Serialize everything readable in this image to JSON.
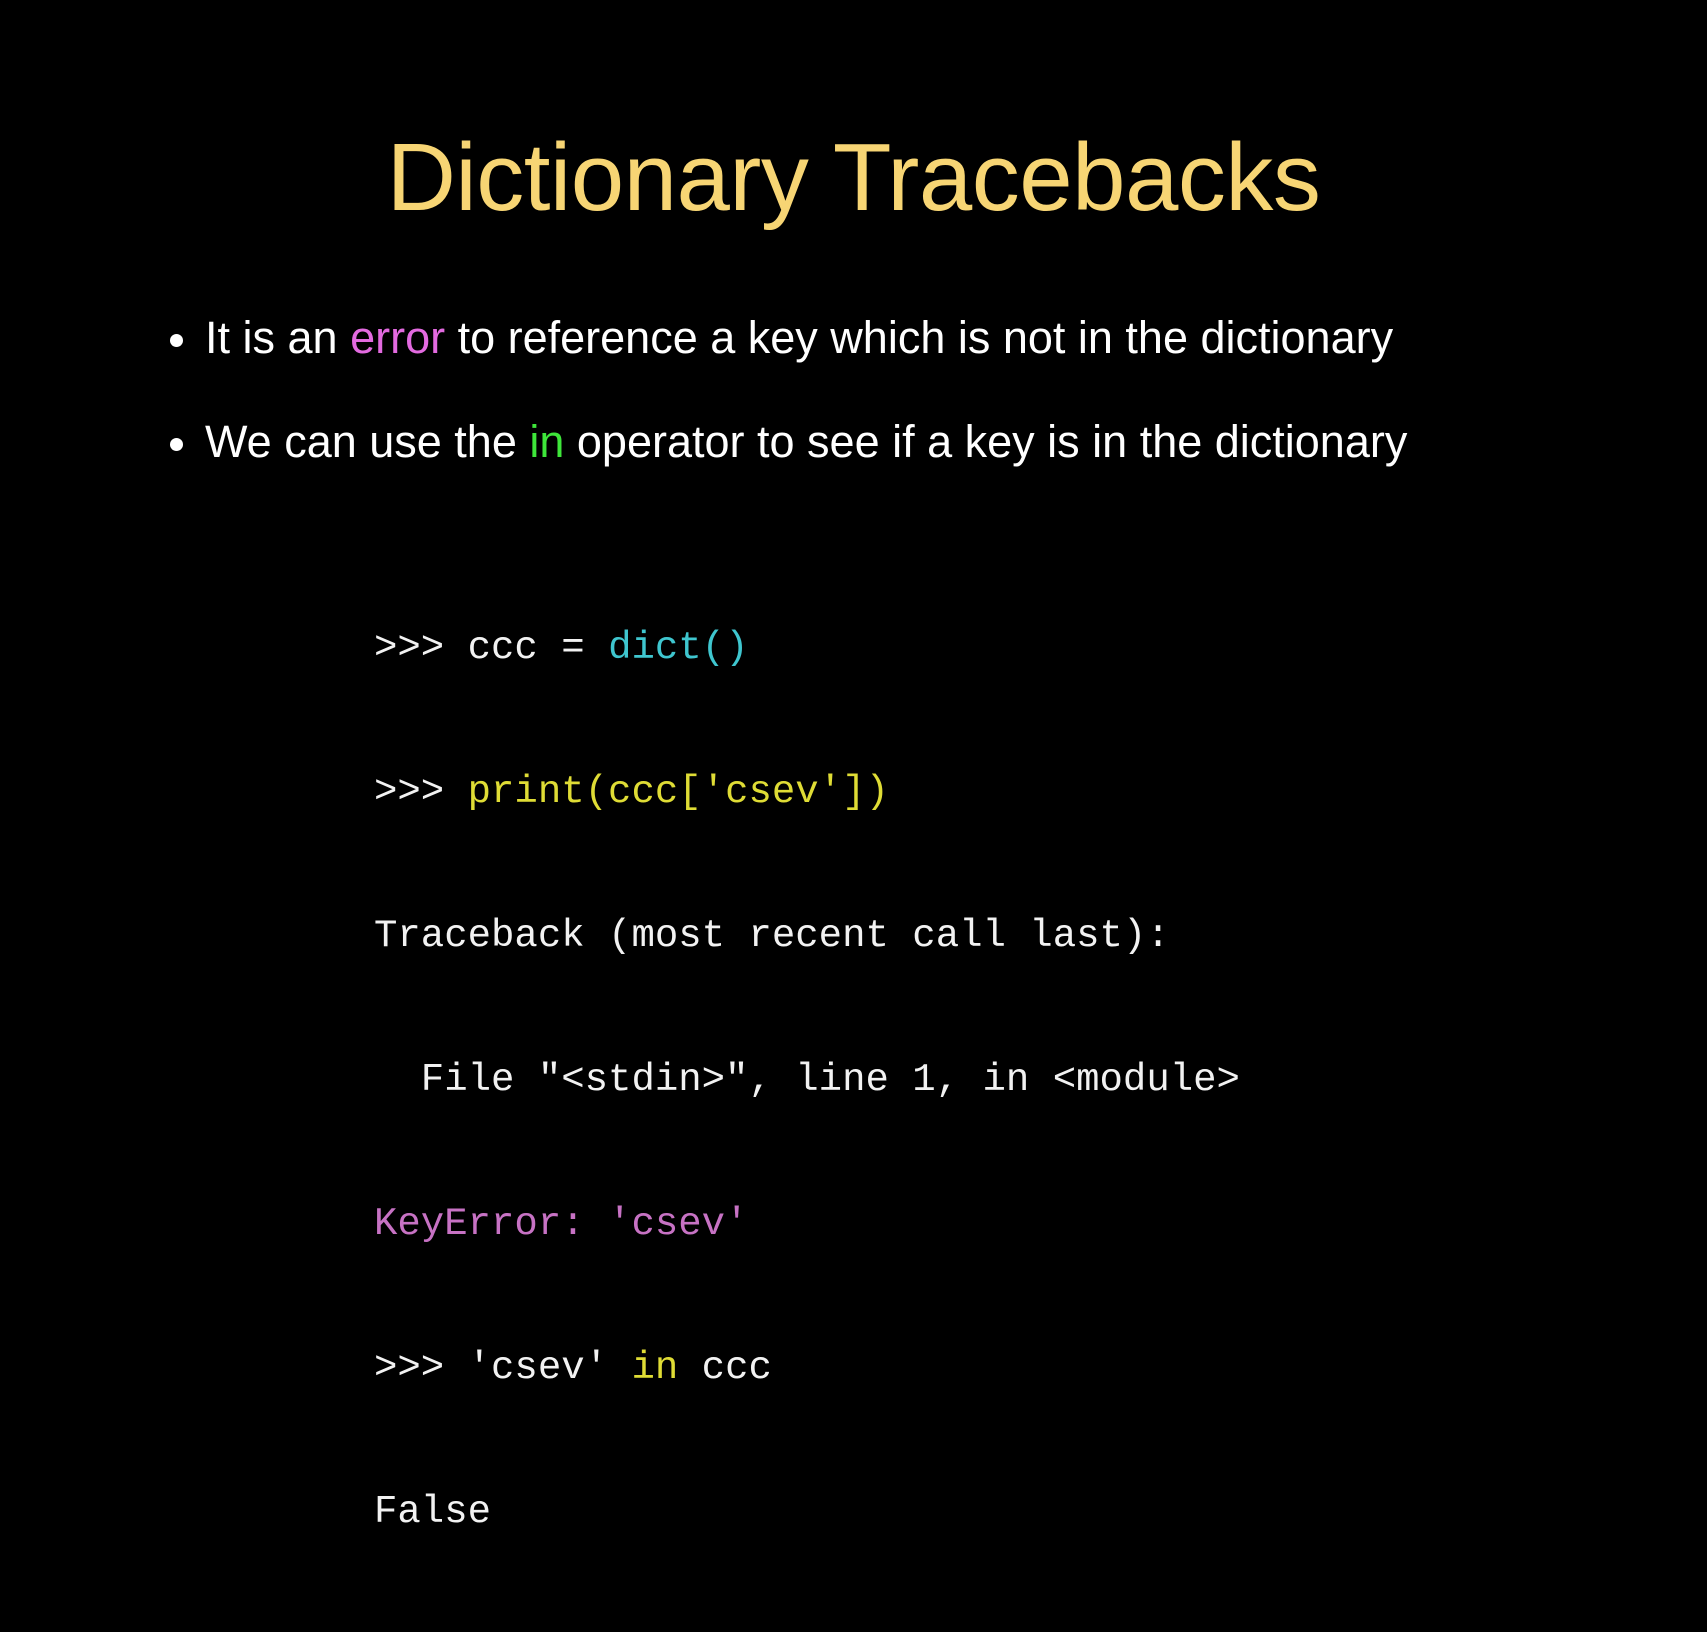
{
  "slide": {
    "title": "Dictionary Tracebacks",
    "bullets": [
      {
        "before": "It is an ",
        "highlight": "error",
        "after": " to reference a key which is not in the dictionary"
      },
      {
        "before": "We can use the ",
        "highlight": "in",
        "after": " operator to see if a key is in the dictionary"
      }
    ],
    "code": {
      "line1": {
        "prompt": ">>> ",
        "text": "ccc = ",
        "call": "dict()"
      },
      "line2": {
        "prompt": ">>> ",
        "call": "print(ccc['csev'])"
      },
      "line3": {
        "text": "Traceback (most recent call last):"
      },
      "line4": {
        "text": "  File \"<stdin>\", line 1, in <module>"
      },
      "line5": {
        "error": "KeyError: 'csev'"
      },
      "line6": {
        "prompt": ">>> ",
        "text": "'csev' ",
        "keyword": "in",
        "after": " ccc"
      },
      "line7": {
        "text": "False"
      }
    }
  },
  "colors": {
    "background": "#000000",
    "title": "#f7d574",
    "body_text": "#ffffff",
    "error_highlight": "#e36ae0",
    "in_highlight": "#3ee63a",
    "code_cyan": "#3fc6cf",
    "code_yellow": "#dfdc35",
    "code_magenta": "#c772c4"
  }
}
